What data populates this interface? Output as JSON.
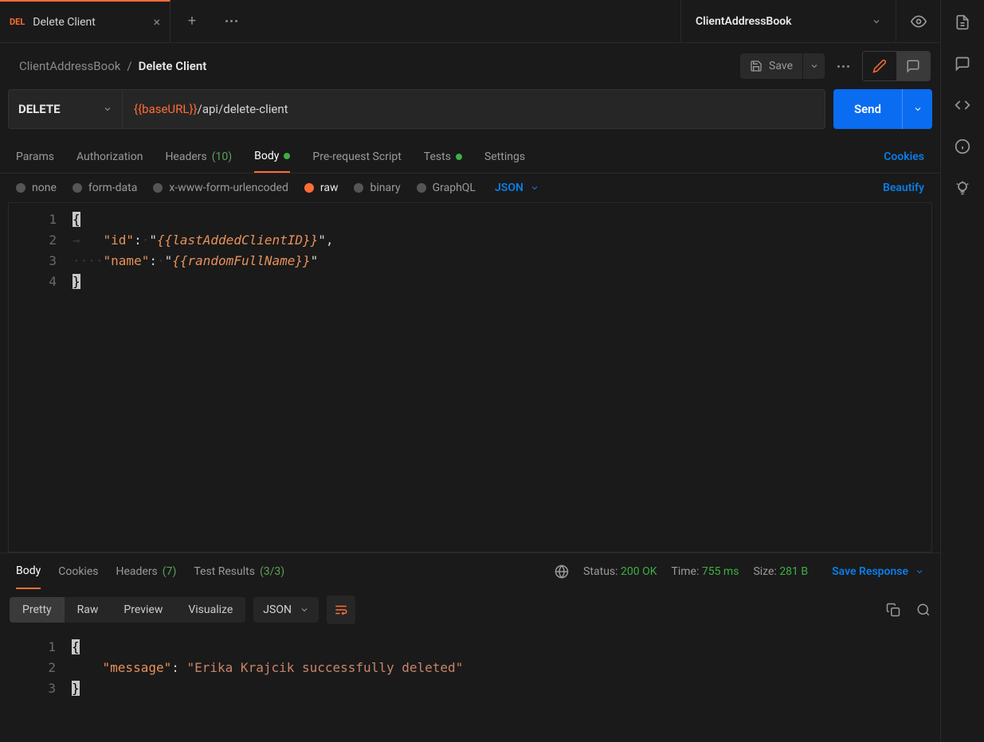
{
  "tab": {
    "badge": "DEL",
    "title": "Delete Client"
  },
  "env": {
    "name": "ClientAddressBook"
  },
  "breadcrumb": {
    "parent": "ClientAddressBook",
    "current": "Delete Client"
  },
  "toolbar": {
    "save": "Save"
  },
  "request": {
    "method": "DELETE",
    "url_var": "{{baseURL}}",
    "url_path": "/api/delete-client",
    "send": "Send"
  },
  "reqTabs": {
    "params": "Params",
    "auth": "Authorization",
    "headers": "Headers",
    "headers_count": "(10)",
    "body": "Body",
    "prereq": "Pre-request Script",
    "tests": "Tests",
    "settings": "Settings",
    "cookies": "Cookies"
  },
  "bodyTypes": {
    "none": "none",
    "formdata": "form-data",
    "xform": "x-www-form-urlencoded",
    "raw": "raw",
    "binary": "binary",
    "graphql": "GraphQL",
    "dtype": "JSON",
    "beautify": "Beautify"
  },
  "reqBody": {
    "l1": "{",
    "l2_key": "\"id\"",
    "l2_colon": ":",
    "l2_val": "{{lastAddedClientID}}",
    "l2_comma": ",",
    "l3_key": "\"name\"",
    "l3_colon": ":",
    "l3_val": "{{randomFullName}}",
    "l4": "}"
  },
  "respTabs": {
    "body": "Body",
    "cookies": "Cookies",
    "headers": "Headers",
    "headers_count": "(7)",
    "testres": "Test Results",
    "testres_count": "(3/3)"
  },
  "respMeta": {
    "status_label": "Status:",
    "status_val": "200 OK",
    "time_label": "Time:",
    "time_val": "755 ms",
    "size_label": "Size:",
    "size_val": "281 B",
    "save": "Save Response"
  },
  "respView": {
    "pretty": "Pretty",
    "raw": "Raw",
    "preview": "Preview",
    "visualize": "Visualize",
    "dtype": "JSON"
  },
  "respBody": {
    "key": "\"message\"",
    "colon": ": ",
    "val": "\"Erika Krajcik successfully deleted\""
  }
}
